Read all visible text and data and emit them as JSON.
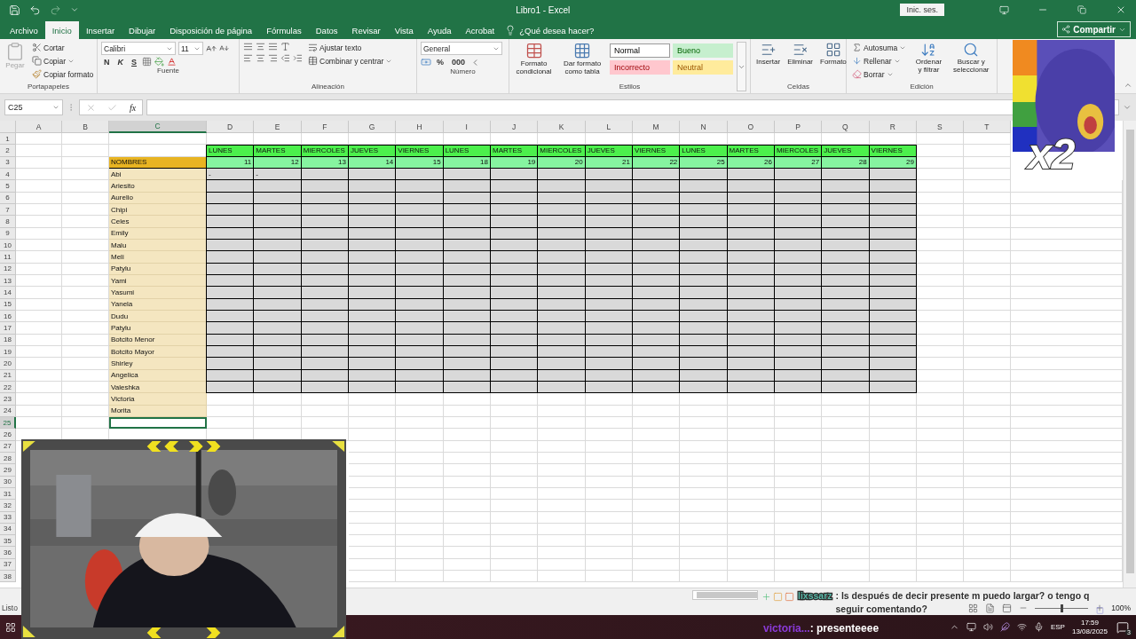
{
  "title_bar": {
    "title": "Libro1  -  Excel",
    "sign_in": "Inic. ses."
  },
  "ribbon_tabs": [
    {
      "label": "Archivo",
      "selected": false
    },
    {
      "label": "Inicio",
      "selected": true
    },
    {
      "label": "Insertar",
      "selected": false
    },
    {
      "label": "Dibujar",
      "selected": false
    },
    {
      "label": "Disposición de página",
      "selected": false
    },
    {
      "label": "Fórmulas",
      "selected": false
    },
    {
      "label": "Datos",
      "selected": false
    },
    {
      "label": "Revisar",
      "selected": false
    },
    {
      "label": "Vista",
      "selected": false
    },
    {
      "label": "Ayuda",
      "selected": false
    },
    {
      "label": "Acrobat",
      "selected": false
    }
  ],
  "tell_me": "¿Qué desea hacer?",
  "share": "Compartir",
  "clipboard": {
    "label": "Portapapeles",
    "paste": "Pegar",
    "paste_disabled": true,
    "cut": "Cortar",
    "copy": "Copiar",
    "format_painter": "Copiar formato"
  },
  "font": {
    "label": "Fuente",
    "font_name": "Calibri",
    "font_size": "11",
    "bold": "N",
    "italic": "K",
    "underline": "S"
  },
  "alignment": {
    "label": "Alineación",
    "wrap": "Ajustar texto",
    "merge": "Combinar y centrar"
  },
  "number": {
    "label": "Número",
    "format": "General",
    "percent": "%",
    "thousands": "000"
  },
  "styles": {
    "label": "Estilos",
    "conditional": "Formato condicional",
    "as_table": "Dar formato como tabla",
    "gallery": [
      {
        "name": "Normal",
        "kind": "normal"
      },
      {
        "name": "Bueno",
        "kind": "good"
      },
      {
        "name": "Incorrecto",
        "kind": "bad"
      },
      {
        "name": "Neutral",
        "kind": "neutral"
      }
    ]
  },
  "cells": {
    "label": "Celdas",
    "items": [
      "Insertar",
      "Eliminar",
      "Formato"
    ]
  },
  "editing": {
    "label": "Edición",
    "autosum": "Autosuma",
    "fill": "Rellenar",
    "clear": "Borrar",
    "sort": "Ordenar y filtrar",
    "find": "Buscar y seleccionar"
  },
  "formula_bar": {
    "name_box": "C25",
    "fx": "fx"
  },
  "sheet": {
    "columns": [
      {
        "label": "A",
        "selected": false
      },
      {
        "label": "B",
        "selected": false
      },
      {
        "label": "C",
        "selected": true
      },
      {
        "label": "D",
        "selected": false
      },
      {
        "label": "E",
        "selected": false
      },
      {
        "label": "F",
        "selected": false
      },
      {
        "label": "G",
        "selected": false
      },
      {
        "label": "H",
        "selected": false
      },
      {
        "label": "I",
        "selected": false
      },
      {
        "label": "J",
        "selected": false
      },
      {
        "label": "K",
        "selected": false
      },
      {
        "label": "L",
        "selected": false
      },
      {
        "label": "M",
        "selected": false
      },
      {
        "label": "N",
        "selected": false
      },
      {
        "label": "O",
        "selected": false
      },
      {
        "label": "P",
        "selected": false
      },
      {
        "label": "Q",
        "selected": false
      },
      {
        "label": "R",
        "selected": false
      },
      {
        "label": "S",
        "selected": false
      },
      {
        "label": "T",
        "selected": false
      }
    ],
    "rows": [
      {
        "label": "1",
        "selected": false
      },
      {
        "label": "2",
        "selected": false
      },
      {
        "label": "3",
        "selected": false
      },
      {
        "label": "4",
        "selected": false
      },
      {
        "label": "5",
        "selected": false
      },
      {
        "label": "6",
        "selected": false
      },
      {
        "label": "7",
        "selected": false
      },
      {
        "label": "8",
        "selected": false
      },
      {
        "label": "9",
        "selected": false
      },
      {
        "label": "10",
        "selected": false
      },
      {
        "label": "11",
        "selected": false
      },
      {
        "label": "12",
        "selected": false
      },
      {
        "label": "13",
        "selected": false
      },
      {
        "label": "14",
        "selected": false
      },
      {
        "label": "15",
        "selected": false
      },
      {
        "label": "16",
        "selected": false
      },
      {
        "label": "17",
        "selected": false
      },
      {
        "label": "18",
        "selected": false
      },
      {
        "label": "19",
        "selected": false
      },
      {
        "label": "20",
        "selected": false
      },
      {
        "label": "21",
        "selected": false
      },
      {
        "label": "22",
        "selected": false
      },
      {
        "label": "23",
        "selected": false
      },
      {
        "label": "24",
        "selected": false
      },
      {
        "label": "25",
        "selected": true
      },
      {
        "label": "26",
        "selected": false
      },
      {
        "label": "27",
        "selected": false
      },
      {
        "label": "28",
        "selected": false
      },
      {
        "label": "29",
        "selected": false
      },
      {
        "label": "30",
        "selected": false
      },
      {
        "label": "31",
        "selected": false
      },
      {
        "label": "32",
        "selected": false
      },
      {
        "label": "33",
        "selected": false
      },
      {
        "label": "34",
        "selected": false
      },
      {
        "label": "35",
        "selected": false
      },
      {
        "label": "36",
        "selected": false
      },
      {
        "label": "37",
        "selected": false
      },
      {
        "label": "38",
        "selected": false
      }
    ],
    "days": [
      {
        "day": "LUNES",
        "date": "11"
      },
      {
        "day": "MARTES",
        "date": "12"
      },
      {
        "day": "MIERCOLES",
        "date": "13"
      },
      {
        "day": "JUEVES",
        "date": "14"
      },
      {
        "day": "VIERNES",
        "date": "15"
      },
      {
        "day": "LUNES",
        "date": "18"
      },
      {
        "day": "MARTES",
        "date": "19"
      },
      {
        "day": "MIERCOLES",
        "date": "20"
      },
      {
        "day": "JUEVES",
        "date": "21"
      },
      {
        "day": "VIERNES",
        "date": "22"
      },
      {
        "day": "LUNES",
        "date": "25"
      },
      {
        "day": "MARTES",
        "date": "26"
      },
      {
        "day": "MIERCOLES",
        "date": "27"
      },
      {
        "day": "JUEVES",
        "date": "28"
      },
      {
        "day": "VIERNES",
        "date": "29"
      }
    ],
    "names_header": "NOMBRES",
    "names": [
      {
        "name": "Abi",
        "grid": true,
        "marks": [
          "-",
          "-"
        ]
      },
      {
        "name": "Ariesito",
        "grid": true
      },
      {
        "name": "Aurelio",
        "grid": true
      },
      {
        "name": "Chipi",
        "grid": true
      },
      {
        "name": "Celes",
        "grid": true
      },
      {
        "name": "Emily",
        "grid": true
      },
      {
        "name": "Malu",
        "grid": true
      },
      {
        "name": "Meli",
        "grid": true
      },
      {
        "name": "Patylu",
        "grid": true
      },
      {
        "name": "Yami",
        "grid": true
      },
      {
        "name": "Yasumi",
        "grid": true
      },
      {
        "name": "Yanela",
        "grid": true
      },
      {
        "name": "Dudu",
        "grid": true
      },
      {
        "name": "Patylu",
        "grid": true
      },
      {
        "name": "Botcito Menor",
        "grid": true
      },
      {
        "name": "Botcito Mayor",
        "grid": true
      },
      {
        "name": "Shirley",
        "grid": true
      },
      {
        "name": "Angelica",
        "grid": true
      },
      {
        "name": "Valeshka",
        "grid": true
      },
      {
        "name": "Victoria",
        "grid": false
      },
      {
        "name": "Morita",
        "grid": false
      }
    ]
  },
  "status_bar": {
    "status": "Listo",
    "zoom": "100%",
    "zoom_slider": {
      "level": 0.5
    }
  },
  "overlay": {
    "badge": "x2",
    "chat": [
      {
        "user": "lixssarz",
        "color": "#58b8a8",
        "message": ": ls después de decir presente m puedo largar? o tengo q seguir comentando?"
      },
      {
        "user": "victoria...",
        "color": "#8a3ad8",
        "message": ": presenteeee"
      }
    ]
  },
  "taskbar": {
    "language": "ESP",
    "time": "17:59",
    "date": "13/08/2025",
    "notifications": "3"
  }
}
